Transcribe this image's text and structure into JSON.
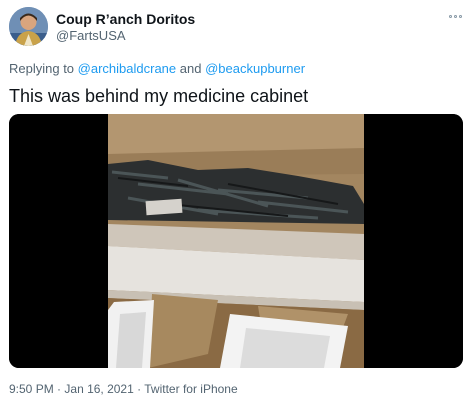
{
  "author": {
    "display_name": "Coup R’anch Doritos",
    "handle": "@FartsUSA"
  },
  "reply": {
    "prefix": "Replying to",
    "users": [
      "@archibaldcrane",
      "@beackupburner"
    ],
    "joiner": "and"
  },
  "tweet": {
    "text": "This was behind my medicine cabinet"
  },
  "media": {
    "type": "video"
  },
  "meta": {
    "time": "9:50 PM",
    "date": "Jan 16, 2021",
    "separator": "·",
    "source": "Twitter for iPhone"
  },
  "icons": {
    "more": "more-horizontal-icon"
  },
  "colors": {
    "link": "#1d9bf0",
    "secondary_text": "#536471",
    "primary_text": "#0f1419"
  }
}
